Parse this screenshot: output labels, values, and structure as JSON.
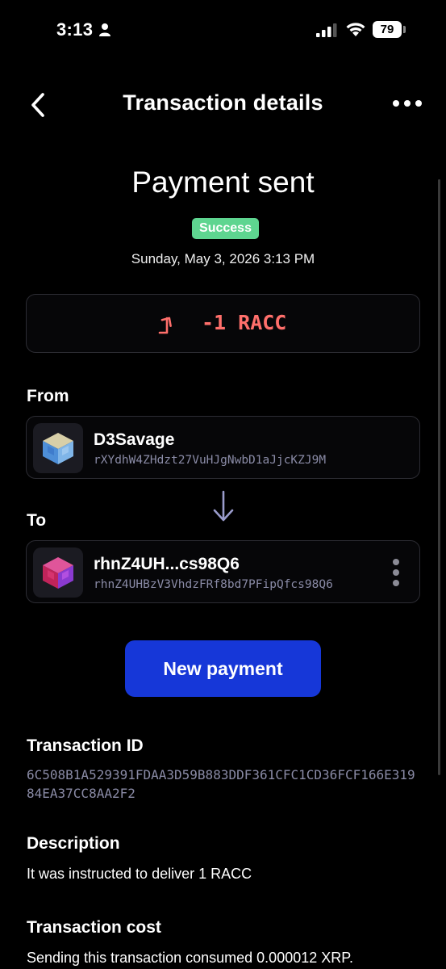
{
  "status_bar": {
    "time": "3:13",
    "battery": "79"
  },
  "header": {
    "title": "Transaction details",
    "back_icon": "chevron-left-icon",
    "more_icon": "more-horizontal-icon"
  },
  "summary": {
    "headline": "Payment sent",
    "status_badge": "Success",
    "date": "Sunday, May 3, 2026 3:13 PM",
    "amount": "-1 RACC",
    "amount_icon": "arrow-up-right-icon"
  },
  "from": {
    "label": "From",
    "name": "D3Savage",
    "address": "rXYdhW4ZHdzt27VuHJgNwbD1aJjcKZJ9M"
  },
  "to": {
    "label": "To",
    "name": "rhnZ4UH...cs98Q6",
    "address": "rhnZ4UHBzV3VhdzFRf8bd7PFipQfcs98Q6"
  },
  "actions": {
    "new_payment": "New payment"
  },
  "details": {
    "transaction_id_label": "Transaction ID",
    "transaction_id": "6C508B1A529391FDAA3D59B883DDF361CFC1CD36FCF166E31984EA37CC8AA2F2",
    "description_label": "Description",
    "description": "It was instructed to deliver 1 RACC",
    "cost_label": "Transaction cost",
    "cost": "Sending this transaction consumed 0.000012 XRP."
  },
  "colors": {
    "background": "#000000",
    "success": "#5ed590",
    "debit": "#ff6f6b",
    "primary_button": "#1637d8",
    "address_text": "#8a8ba6"
  }
}
